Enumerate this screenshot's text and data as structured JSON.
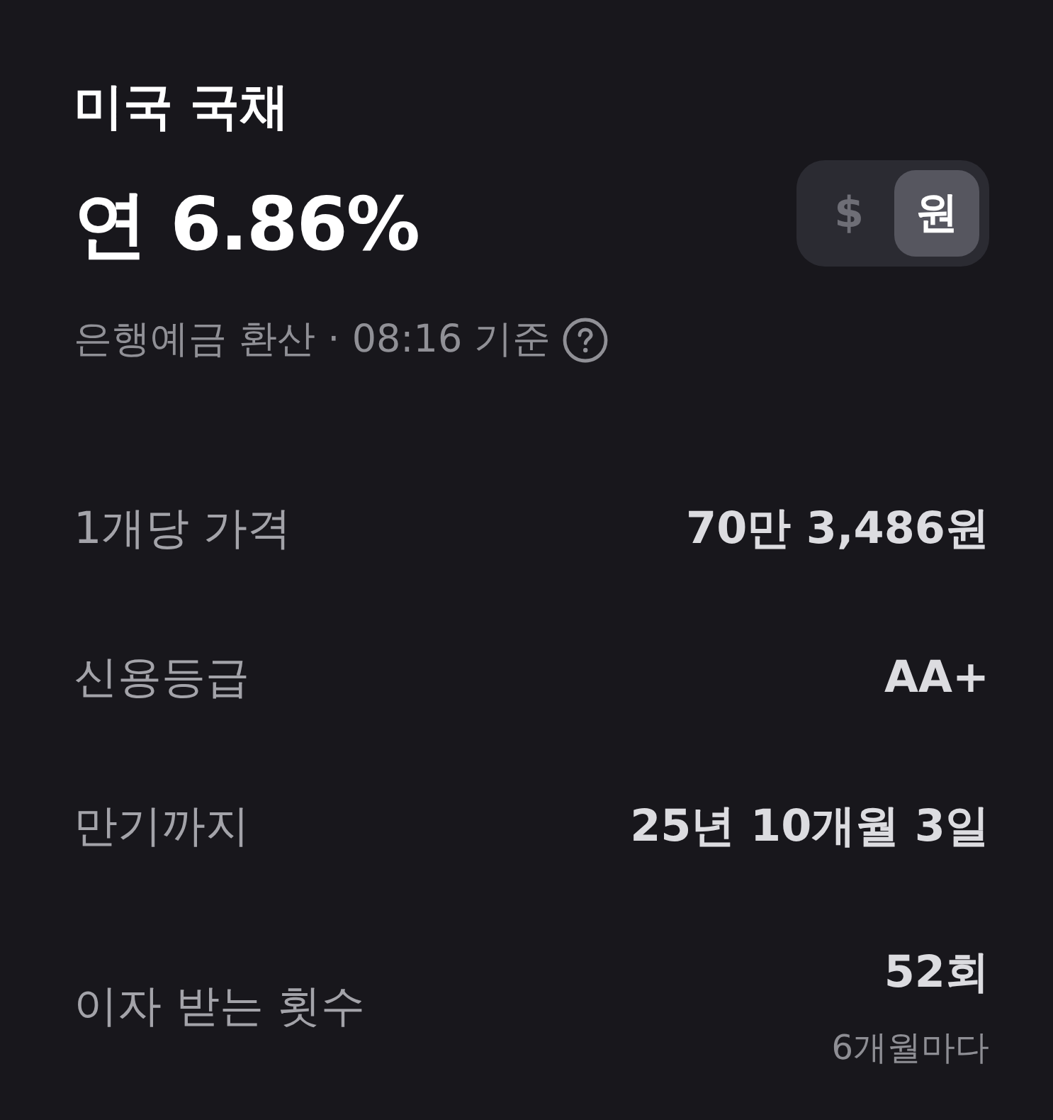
{
  "header": {
    "title": "미국 국채",
    "rate": "연 6.86%",
    "note": "은행예금 환산 · 08:16 기준"
  },
  "currency_toggle": {
    "options": [
      {
        "label": "$",
        "selected": false
      },
      {
        "label": "원",
        "selected": true
      }
    ]
  },
  "details": [
    {
      "label": "1개당 가격",
      "value": "70만 3,486원"
    },
    {
      "label": "신용등급",
      "value": "AA+"
    },
    {
      "label": "만기까지",
      "value": "25년 10개월 3일"
    },
    {
      "label": "이자 받는 횟수",
      "value": "52회",
      "subvalue": "6개월마다"
    }
  ]
}
